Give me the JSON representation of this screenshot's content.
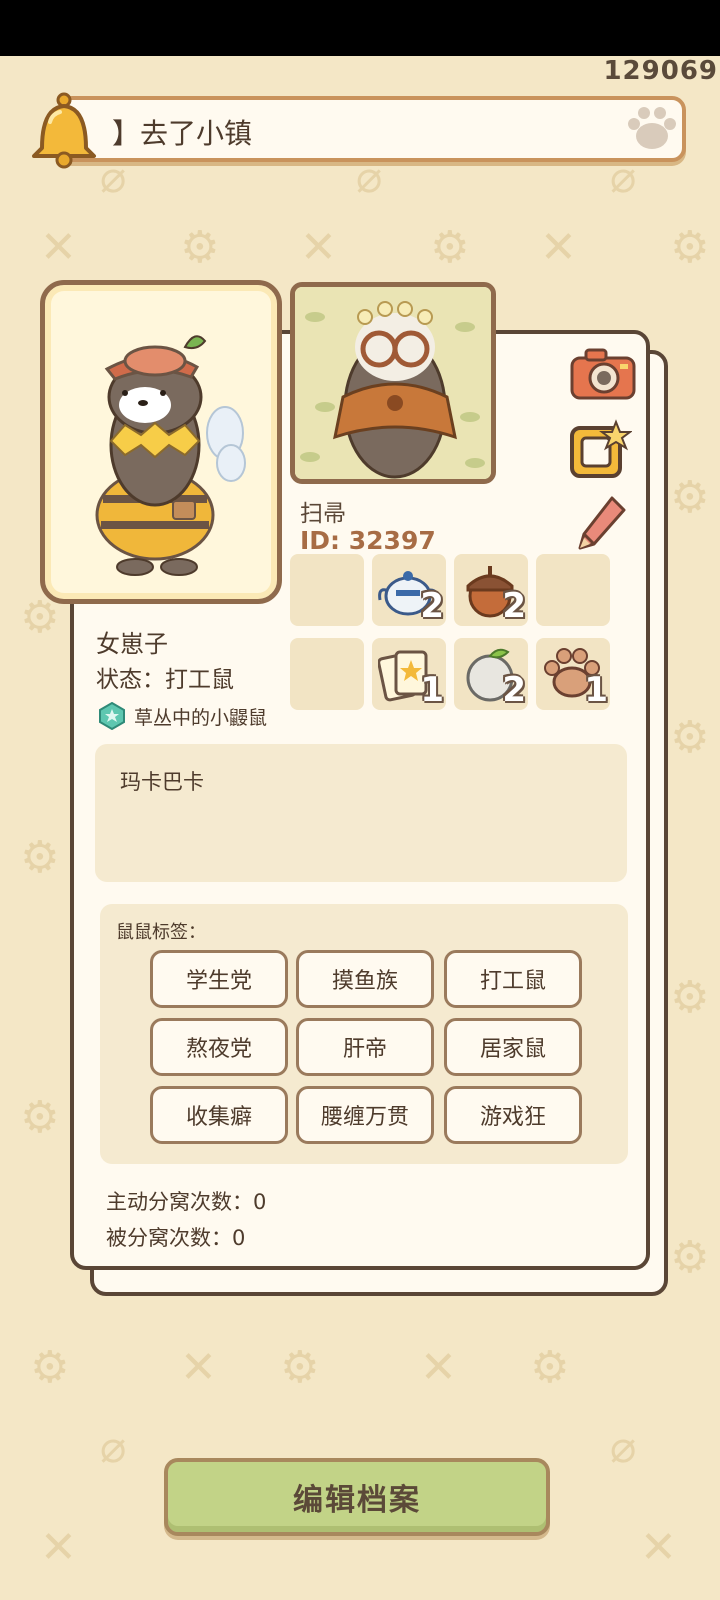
{
  "top_counter": "129069",
  "notification": {
    "text": "】去了小镇"
  },
  "profile": {
    "character_name": "扫帚",
    "character_id": "ID: 32397",
    "nickname": "女崽子",
    "status": "状态：打工鼠",
    "badge": "草丛中的小鼹鼠",
    "bio": "玛卡巴卡"
  },
  "inventory": [
    {
      "icon": "empty",
      "count": ""
    },
    {
      "icon": "teapot-icon",
      "count": "2"
    },
    {
      "icon": "acorn-icon",
      "count": "2"
    },
    {
      "icon": "empty",
      "count": ""
    },
    {
      "icon": "empty",
      "count": ""
    },
    {
      "icon": "cards-icon",
      "count": "1"
    },
    {
      "icon": "apple-icon",
      "count": "2"
    },
    {
      "icon": "paw-token-icon",
      "count": "1"
    }
  ],
  "tags": {
    "title": "鼠鼠标签：",
    "items": [
      "学生党",
      "摸鱼族",
      "打工鼠",
      "熬夜党",
      "肝帝",
      "居家鼠",
      "收集癖",
      "腰缠万贯",
      "游戏狂"
    ]
  },
  "stats": {
    "active_split": "主动分窝次数：0",
    "passive_split": "被分窝次数：0"
  },
  "buttons": {
    "edit_profile": "编辑档案"
  },
  "colors": {
    "background": "#f4e7c6",
    "card": "#fffaf0",
    "border": "#5a4636",
    "id_text": "#a76c45",
    "button_green": "#c2d387"
  }
}
